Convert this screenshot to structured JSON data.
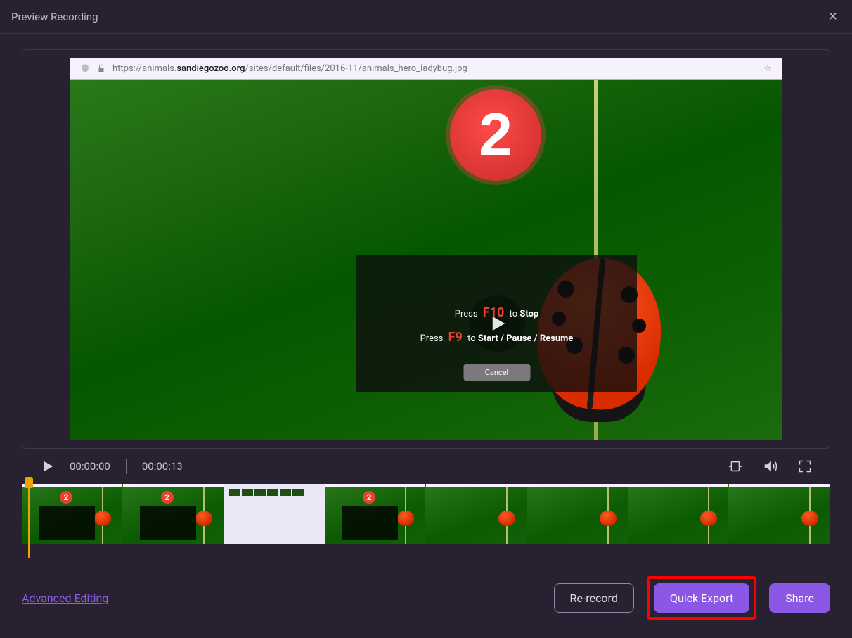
{
  "window": {
    "title": "Preview Recording"
  },
  "url": {
    "prefix": "https://animals.",
    "host": "sandiegozoo.org",
    "path": "/sites/default/files/2016-11/animals_hero_ladybug.jpg"
  },
  "countdown": {
    "number": "2"
  },
  "overlay": {
    "press1": "Press",
    "f10": "F10",
    "to1": "to",
    "stop": "Stop",
    "press2": "Press",
    "f9": "F9",
    "to2": "to",
    "start": "Start",
    "pause": "Pause",
    "resume": "Resume",
    "slash1": "/",
    "slash2": "/",
    "cancel": "Cancel"
  },
  "playback": {
    "current": "00:00:00",
    "total": "00:00:13"
  },
  "thumbnails": {
    "count_label": "2"
  },
  "footer": {
    "advanced": "Advanced Editing",
    "re_record": "Re-record",
    "quick_export": "Quick Export",
    "share": "Share"
  },
  "colors": {
    "accent_purple": "#8a57e6",
    "highlight_red": "#ff0000",
    "countdown_red": "#e8412f"
  }
}
